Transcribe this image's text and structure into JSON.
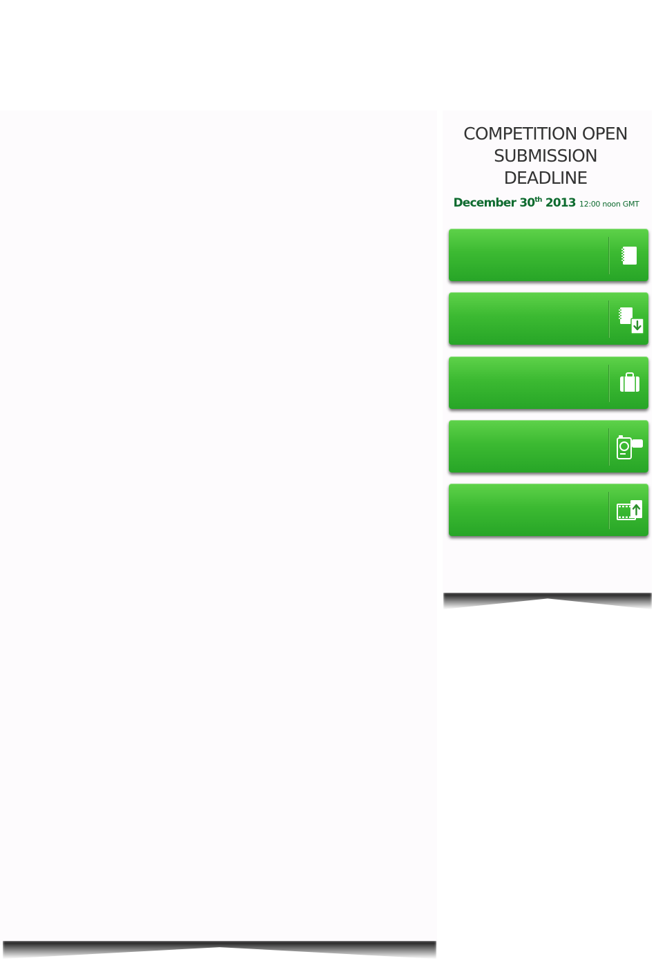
{
  "sidebar": {
    "headline_line1": "COMPETITION OPEN",
    "headline_line2": "SUBMISSION",
    "headline_line3": "DEADLINE",
    "deadline_date": "December 30",
    "deadline_suffix": "th",
    "deadline_year": "2013",
    "deadline_time": "12:00 noon GMT",
    "buttons": [
      {
        "label": "",
        "icon": "notebook-icon"
      },
      {
        "label": "",
        "icon": "document-download-icon"
      },
      {
        "label": "",
        "icon": "briefcase-icon"
      },
      {
        "label": "",
        "icon": "video-camera-icon"
      },
      {
        "label": "",
        "icon": "film-upload-icon"
      }
    ]
  },
  "colors": {
    "button_green_top": "#5fd24a",
    "button_green_bottom": "#27a527",
    "deadline_green": "#0e6b2f",
    "headline_text": "#333333",
    "panel_background": "#fdfbfd"
  }
}
